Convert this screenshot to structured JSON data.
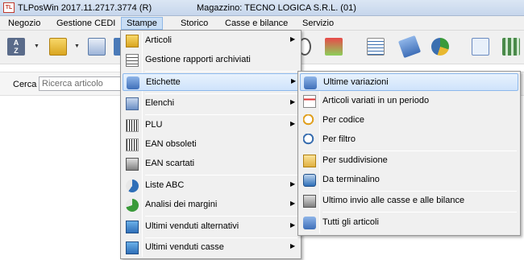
{
  "window": {
    "title": "TLPosWin 2017.11.2717.3774 (R)",
    "subtitle": "Magazzino: TECNO LOGICA S.R.L. (01)"
  },
  "menubar": [
    {
      "label": "Negozio"
    },
    {
      "label": "Gestione CEDI"
    },
    {
      "label": "Stampe"
    },
    {
      "label": "Storico"
    },
    {
      "label": "Casse e bilance"
    },
    {
      "label": "Servizio"
    }
  ],
  "search": {
    "label": "Cerca",
    "placeholder": "Ricerca articolo"
  },
  "stampe_menu": {
    "items": [
      {
        "label": "Articoli",
        "icon": "folder-icon",
        "submenu": true
      },
      {
        "label": "Gestione rapporti archiviati",
        "icon": "report-list-icon",
        "submenu": false
      },
      {
        "label": "Etichette",
        "icon": "label-tag-icon",
        "submenu": true,
        "highlighted": true
      },
      {
        "label": "Elenchi",
        "icon": "list-icon",
        "submenu": true
      },
      {
        "label": "PLU",
        "icon": "barcode-icon",
        "submenu": true
      },
      {
        "label": "EAN obsoleti",
        "icon": "barcode-icon",
        "submenu": false
      },
      {
        "label": "EAN scartati",
        "icon": "printer-icon",
        "submenu": false
      },
      {
        "label": "Liste ABC",
        "icon": "abc-chart-icon",
        "submenu": true
      },
      {
        "label": "Analisi dei margini",
        "icon": "margin-chart-icon",
        "submenu": true
      },
      {
        "label": "Ultimi venduti alternativi",
        "icon": "sales-icon",
        "submenu": true
      },
      {
        "label": "Ultimi venduti casse",
        "icon": "cash-register-icon",
        "submenu": true
      }
    ]
  },
  "etichette_menu": {
    "items": [
      {
        "label": "Ultime variazioni",
        "icon": "label-tag-icon",
        "highlighted": true
      },
      {
        "label": "Articoli variati in un periodo",
        "icon": "calendar-icon"
      },
      {
        "label": "Per codice",
        "icon": "magnifier-icon"
      },
      {
        "label": "Per filtro",
        "icon": "magnifier-icon"
      },
      {
        "label": "Per suddivisione",
        "icon": "folder-open-icon"
      },
      {
        "label": "Da terminalino",
        "icon": "handheld-terminal-icon"
      },
      {
        "label": "Ultimo invio alle casse e alle bilance",
        "icon": "printer-icon"
      },
      {
        "label": "Tutti gli articoli",
        "icon": "label-tag-icon"
      }
    ]
  },
  "colors": {
    "highlight": "#cfe3fb",
    "menu_bg": "#f0f0f0",
    "titlebar": "#c6d6ec"
  }
}
